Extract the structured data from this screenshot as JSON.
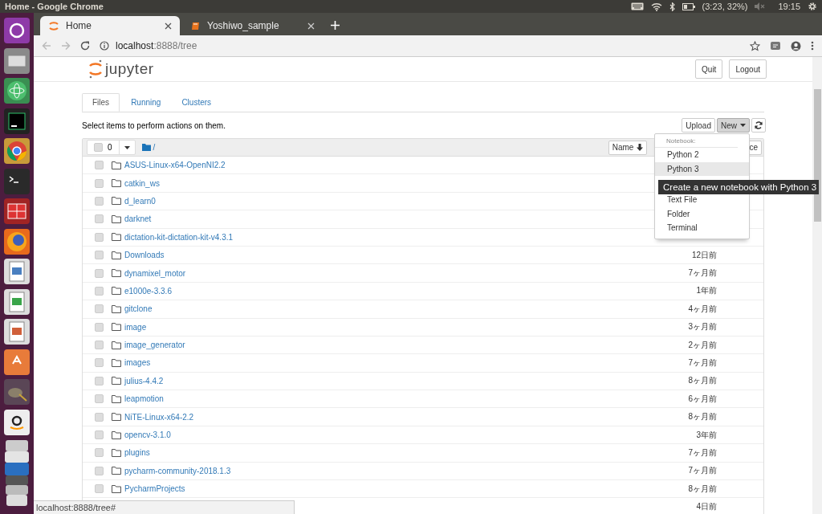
{
  "os_panel": {
    "title": "Home - Google Chrome",
    "battery": "(3:23, 32%)",
    "clock": "19:15"
  },
  "browser": {
    "tabs": [
      {
        "label": "Home",
        "selected": true,
        "kind": "jupyter"
      },
      {
        "label": "Yoshiwo_sample",
        "selected": false,
        "kind": "book"
      }
    ],
    "address": "**localhost**:8888/tree"
  },
  "header": {
    "logo": "jupyter",
    "buttons": [
      "Quit",
      "Logout"
    ]
  },
  "tabs": [
    {
      "label": "Files",
      "selected": true
    },
    {
      "label": "Running",
      "selected": false
    },
    {
      "label": "Clusters",
      "selected": false
    }
  ],
  "hint": "Select items to perform actions on them.",
  "toolbar": {
    "upload": "Upload",
    "new": {
      "label": "New",
      "expanded": true
    }
  },
  "list_header": {
    "all_checked": false,
    "selected_count": "0",
    "path": "/",
    "sort_button": "Name",
    "column_3": "ce"
  },
  "new_menu": {
    "header": "Notebook:",
    "items": [
      {
        "label": "Python 2",
        "hovered": false
      },
      {
        "label": "Python 3",
        "hovered": true
      },
      {
        "label": "Text File",
        "hovered": false
      },
      {
        "label": "Folder",
        "hovered": false
      },
      {
        "label": "Terminal",
        "hovered": false
      }
    ]
  },
  "tooltip": "Create a new notebook with Python 3",
  "rows": [
    {
      "name": "ASUS-Linux-x64-OpenNI2.2",
      "checked": false
    },
    {
      "name": "catkin_ws",
      "checked": false
    },
    {
      "name": "d_learn0",
      "checked": false
    },
    {
      "name": "darknet",
      "checked": false
    },
    {
      "name": "dictation-kit-dictation-kit-v4.3.1",
      "checked": false
    },
    {
      "name": "Downloads",
      "checked": false,
      "modified": "12日前"
    },
    {
      "name": "dynamixel_motor",
      "checked": false,
      "modified": "7ヶ月前"
    },
    {
      "name": "e1000e-3.3.6",
      "checked": false,
      "modified": "1年前"
    },
    {
      "name": "gitclone",
      "checked": false,
      "modified": "4ヶ月前"
    },
    {
      "name": "image",
      "checked": false,
      "modified": "3ヶ月前"
    },
    {
      "name": "image_generator",
      "checked": false,
      "modified": "2ヶ月前"
    },
    {
      "name": "images",
      "checked": false,
      "modified": "7ヶ月前"
    },
    {
      "name": "julius-4.4.2",
      "checked": false,
      "modified": "8ヶ月前"
    },
    {
      "name": "leapmotion",
      "checked": false,
      "modified": "6ヶ月前"
    },
    {
      "name": "NiTE-Linux-x64-2.2",
      "checked": false,
      "modified": "8ヶ月前"
    },
    {
      "name": "opencv-3.1.0",
      "checked": false,
      "modified": "3年前"
    },
    {
      "name": "plugins",
      "checked": false,
      "modified": "7ヶ月前"
    },
    {
      "name": "pycharm-community-2018.1.3",
      "checked": false,
      "modified": "7ヶ月前"
    },
    {
      "name": "PycharmProjects",
      "checked": false,
      "modified": "8ヶ月前"
    },
    {
      "modified": "4日前"
    }
  ],
  "status_bubble": "localhost:8888/tree#"
}
